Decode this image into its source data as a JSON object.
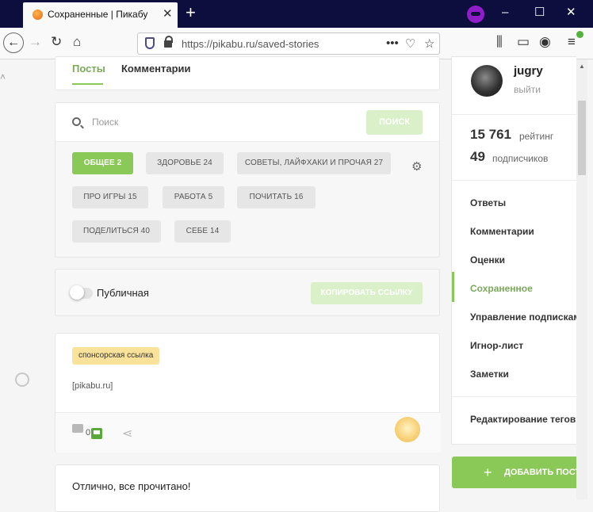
{
  "browser": {
    "tab_title": "Сохраненные | Пикабу",
    "tab_close": "✕",
    "new_tab": "+",
    "url": "https://pikabu.ru/saved-stories",
    "minimize": "–",
    "maximize": "☐",
    "close": "✕"
  },
  "profile_tabs": {
    "posts": "Посты",
    "comments": "Комментарии"
  },
  "search": {
    "placeholder": "Поиск",
    "button": "ПОИСК"
  },
  "filter_chips": [
    {
      "label": "ОБЩЕЕ 2",
      "active": true
    },
    {
      "label": "ЗДОРОВЬЕ 24",
      "active": false
    },
    {
      "label": "СОВЕТЫ, ЛАЙФХАКИ И ПРОЧАЯ 27",
      "active": false
    },
    {
      "label": "ПРО ИГРЫ 15",
      "active": false
    },
    {
      "label": "РАБОТА 5",
      "active": false
    },
    {
      "label": "ПОЧИТАТЬ 16",
      "active": false
    },
    {
      "label": "ПОДЕЛИТЬСЯ 40",
      "active": false
    },
    {
      "label": "СЕБЕ 14",
      "active": false
    }
  ],
  "public": {
    "label": "Публичная",
    "copy_button": "КОПИРОВАТЬ ССЫЛКУ",
    "enabled": false
  },
  "sponsor": {
    "badge": "спонсорская ссылка",
    "link": "[pikabu.ru]",
    "comment_count": "0"
  },
  "done_message": "Отлично, все прочитано!",
  "user": {
    "name": "jugry",
    "exit": "выйти",
    "rating_value": "15 761",
    "rating_label": "рейтинг",
    "subscribers_value": "49",
    "subscribers_label": "подписчиков"
  },
  "menu": [
    "Ответы",
    "Комментарии",
    "Оценки",
    "Сохраненное",
    "Управление подписками",
    "Игнор-лист",
    "Заметки",
    "Редактирование тегов"
  ],
  "add_post_button": "ДОБАВИТЬ ПОСТ",
  "colors": {
    "accent_green": "#8ac858",
    "titlebar": "#0d0d3e",
    "private_purple": "#8f1ec8",
    "sponsor_badge": "#fbe29a"
  }
}
